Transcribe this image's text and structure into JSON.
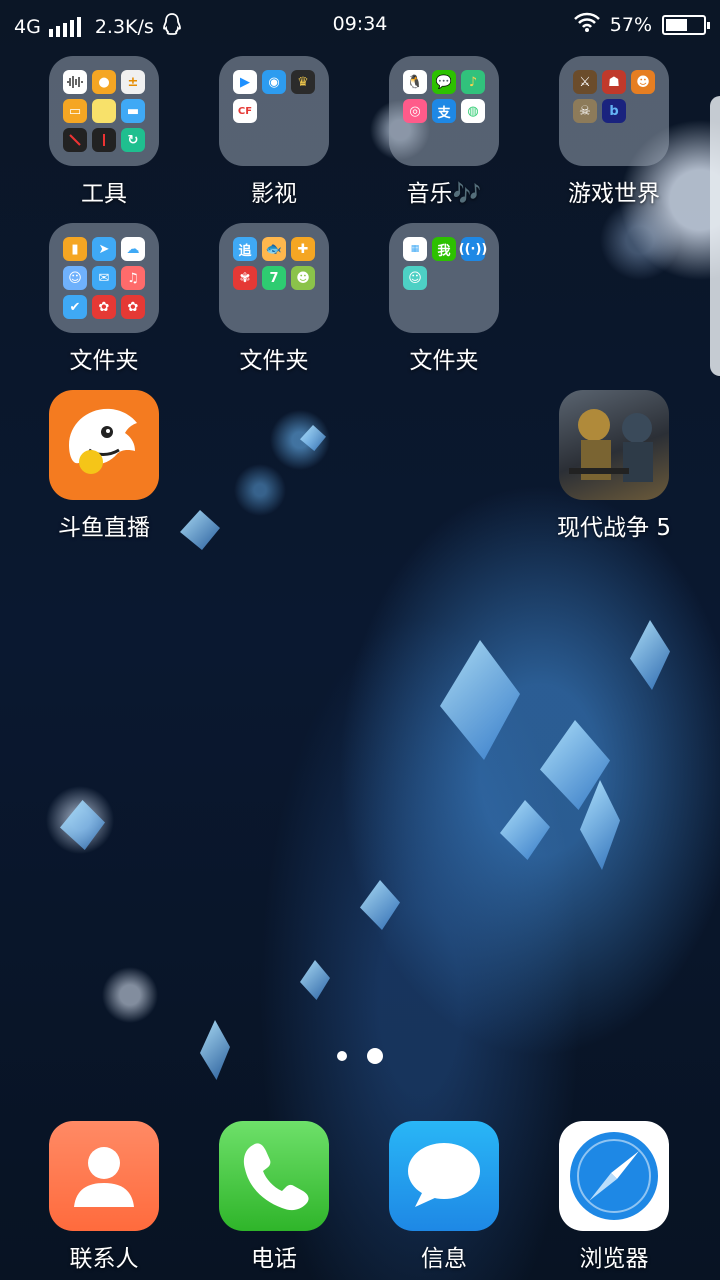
{
  "status": {
    "network": "4G",
    "speed": "2.3K/s",
    "time": "09:34",
    "battery_pct": "57%",
    "battery_level": 0.57
  },
  "page_indicator": {
    "pages": 2,
    "current": 2
  },
  "apps": {
    "tools_folder": {
      "label": "工具"
    },
    "video_folder": {
      "label": "影视"
    },
    "music_folder": {
      "label": "音乐🎶"
    },
    "games_folder": {
      "label": "游戏世界"
    },
    "folder1": {
      "label": "文件夹"
    },
    "folder2": {
      "label": "文件夹"
    },
    "folder3": {
      "label": "文件夹"
    },
    "douyu": {
      "label": "斗鱼直播"
    },
    "modern_combat": {
      "label": "现代战争 5"
    }
  },
  "folder_mini_text": {
    "zhui": "追",
    "wo": "我",
    "zhi": "支",
    "seven": "7",
    "cf": "CF",
    "b": "b"
  },
  "dock": {
    "contacts": "联系人",
    "phone": "电话",
    "messages": "信息",
    "browser": "浏览器"
  },
  "colors": {
    "accent_blue": "#1e90ff",
    "douyu_orange": "#f47b20",
    "phone_green": "#3ec43a"
  }
}
